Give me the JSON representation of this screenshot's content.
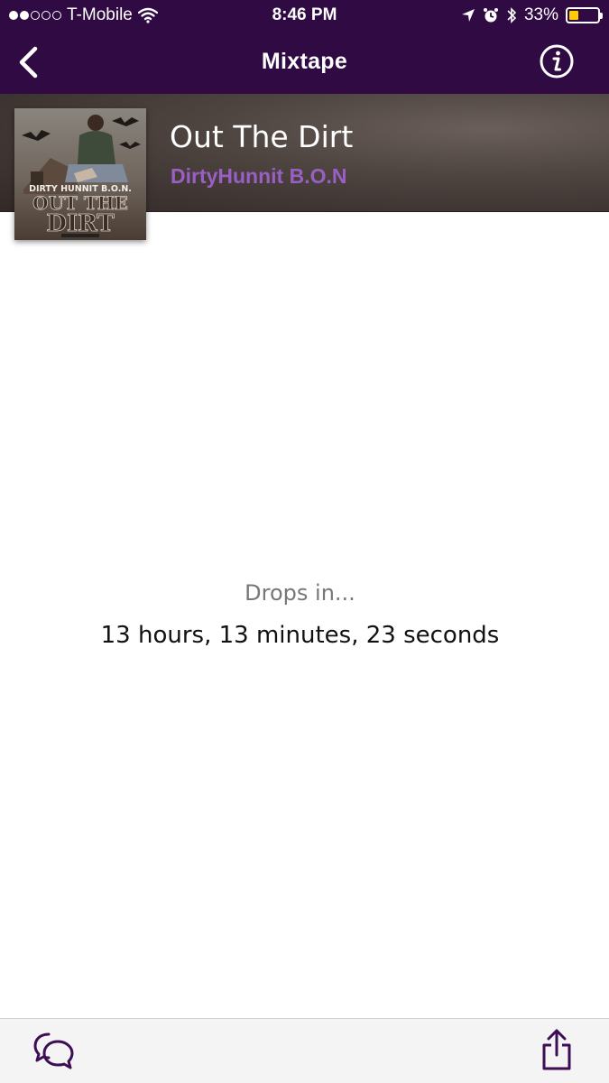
{
  "status_bar": {
    "carrier": "T-Mobile",
    "time": "8:46 PM",
    "battery_percent": "33%",
    "battery_level": 0.33,
    "signal_bars_filled": 2,
    "signal_bars_total": 5
  },
  "nav": {
    "title": "Mixtape"
  },
  "album": {
    "title": "Out The Dirt",
    "artist": "DirtyHunnit B.O.N",
    "cover_text_top": "DIRTY HUNNIT B.O.N.",
    "cover_text_line1": "OUT THE",
    "cover_text_line2": "DIRT"
  },
  "countdown": {
    "label": "Drops in...",
    "value": "13 hours, 13 minutes, 23 seconds"
  },
  "colors": {
    "nav_background": "#2f0a43",
    "artist_purple": "#9a5fc4",
    "battery_yellow": "#ffcc00",
    "icon_purple": "#3d0d55"
  },
  "icons": {
    "back": "chevron-left-icon",
    "info": "info-circle-icon",
    "chat": "chat-bubbles-icon",
    "share": "share-icon"
  }
}
